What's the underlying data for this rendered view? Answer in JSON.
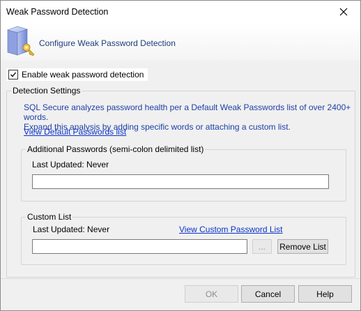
{
  "window": {
    "title": "Weak Password Detection"
  },
  "header": {
    "title": "Configure Weak Password Detection",
    "icon": "server-key-icon"
  },
  "enable": {
    "label": "Enable weak password detection",
    "checked": true
  },
  "detection_settings": {
    "legend": "Detection Settings",
    "description_line1": "SQL Secure analyzes password health per a Default Weak Passwords list of over 2400+ words.",
    "description_line2": "Expand this analysis by adding specific words or attaching a custom list.",
    "view_default_link": "View Default Passwords list"
  },
  "additional_passwords": {
    "legend": "Additional Passwords (semi-colon delimited list)",
    "last_updated": "Last Updated: Never",
    "value": ""
  },
  "custom_list": {
    "legend": "Custom List",
    "last_updated": "Last Updated: Never",
    "view_link": "View Custom Password List",
    "value": "",
    "browse_label": "...",
    "remove_label": "Remove List"
  },
  "buttons": {
    "ok": "OK",
    "cancel": "Cancel",
    "help": "Help"
  }
}
